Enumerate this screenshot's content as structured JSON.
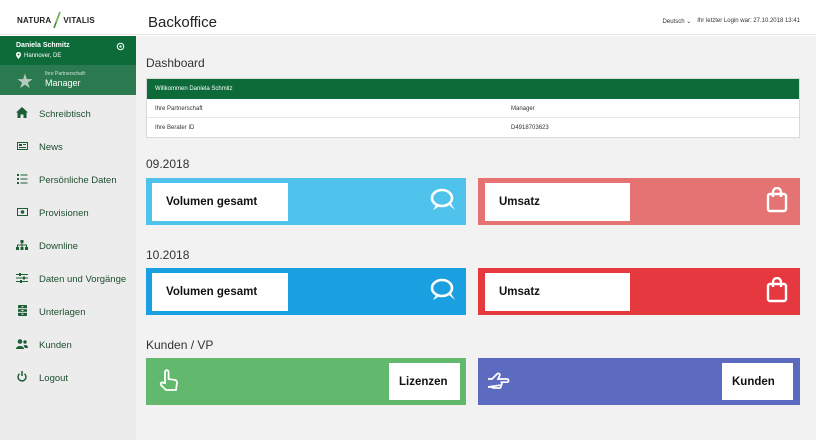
{
  "header": {
    "logo_left": "NATURA",
    "logo_right": "VITALIS",
    "title": "Backoffice",
    "language": "Deutsch",
    "language_chevron": "⌄",
    "last_login": "Ihr letzter Login war: 27.10.2018 13:41"
  },
  "user": {
    "name": "Daniela Schmitz",
    "location": "Hannover, DE",
    "partner_label": "Ihre Partnerschaft:",
    "partner_value": "Manager"
  },
  "nav": [
    {
      "label": "Schreibtisch",
      "icon": "home-icon"
    },
    {
      "label": "News",
      "icon": "newspaper-icon"
    },
    {
      "label": "Persönliche Daten",
      "icon": "list-icon"
    },
    {
      "label": "Provisionen",
      "icon": "money-icon"
    },
    {
      "label": "Downline",
      "icon": "sitemap-icon"
    },
    {
      "label": "Daten und Vorgänge",
      "icon": "sliders-icon"
    },
    {
      "label": "Unterlagen",
      "icon": "archive-icon"
    },
    {
      "label": "Kunden",
      "icon": "users-icon"
    },
    {
      "label": "Logout",
      "icon": "power-icon"
    }
  ],
  "main": {
    "dashboard_title": "Dashboard",
    "welcome": {
      "header": "Willkommen Daniela Schmitz",
      "rows": [
        {
          "key": "Ihre Partnerschaft",
          "value": "Manager"
        },
        {
          "key": "Ihre Berater ID",
          "value": "D4918703623"
        }
      ]
    },
    "period1": {
      "title": "09.2018",
      "volume_label": "Volumen gesamt",
      "revenue_label": "Umsatz"
    },
    "period2": {
      "title": "10.2018",
      "volume_label": "Volumen gesamt",
      "revenue_label": "Umsatz"
    },
    "customers": {
      "title": "Kunden / VP",
      "licenses_label": "Lizenzen",
      "customers_label": "Kunden"
    }
  },
  "colors": {
    "brand_green": "#0d6b3a",
    "light_blue": "#4fc3ec",
    "blue": "#1a9fe0",
    "light_red": "#e57373",
    "red": "#e5393f",
    "green": "#62b96d",
    "indigo": "#5c6bc0"
  }
}
